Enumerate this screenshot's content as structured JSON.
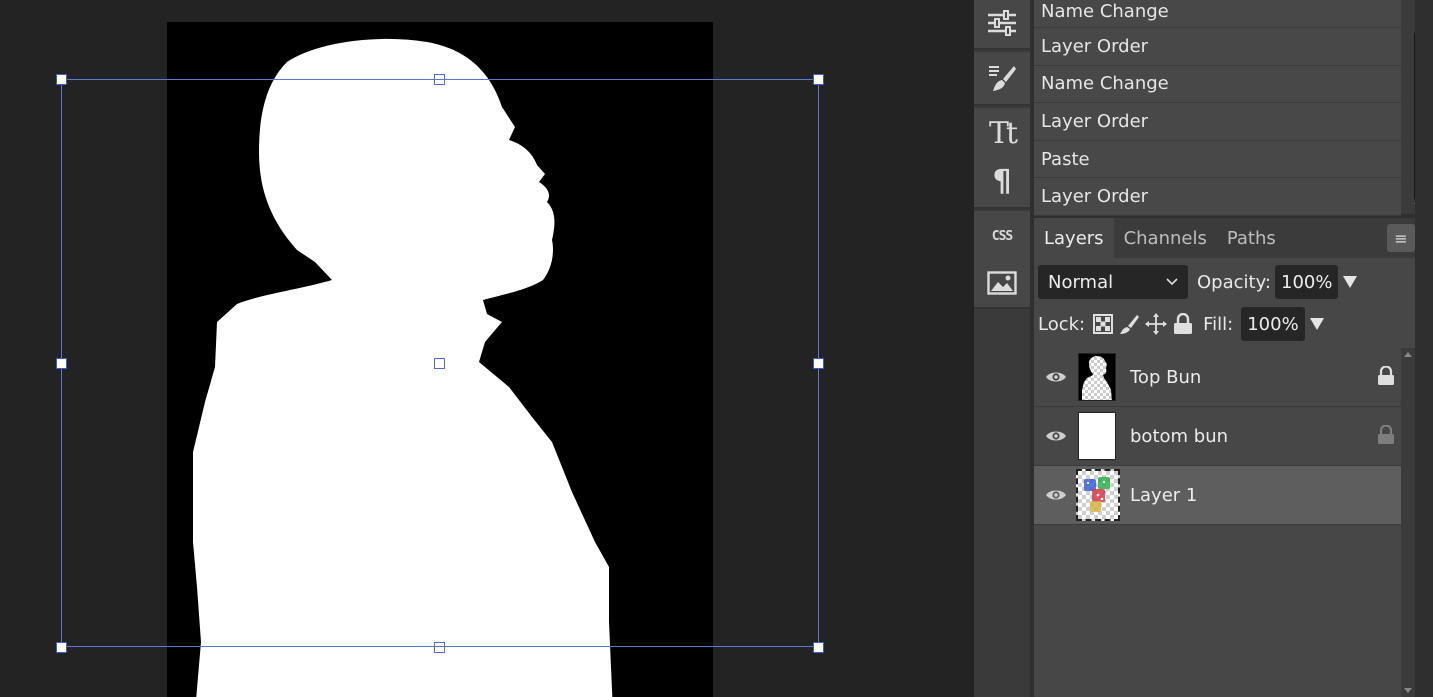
{
  "history": {
    "items": [
      {
        "label": "Name Change"
      },
      {
        "label": "Layer Order"
      },
      {
        "label": "Name Change"
      },
      {
        "label": "Layer Order"
      },
      {
        "label": "Paste"
      },
      {
        "label": "Layer Order"
      }
    ]
  },
  "tools": [
    {
      "icon": "adjustments-sliders-icon"
    },
    {
      "icon": "brush-settings-icon"
    },
    {
      "icon": "character-text-icon"
    },
    {
      "icon": "paragraph-icon"
    },
    {
      "icon": "css-icon"
    },
    {
      "icon": "image-icon"
    }
  ],
  "layers_panel": {
    "tabs": [
      {
        "label": "Layers",
        "active": true
      },
      {
        "label": "Channels",
        "active": false
      },
      {
        "label": "Paths",
        "active": false
      }
    ],
    "menu_glyph": "≡",
    "blend_mode": "Normal",
    "opacity_label": "Opacity:",
    "opacity_value": "100%",
    "lock_label": "Lock:",
    "fill_label": "Fill:",
    "fill_value": "100%",
    "layers": [
      {
        "name": "Top Bun",
        "visible": true,
        "locked": true,
        "selected": false,
        "thumb": "silhouette"
      },
      {
        "name": "botom bun",
        "visible": true,
        "locked": true,
        "selected": false,
        "thumb": "white"
      },
      {
        "name": "Layer 1",
        "visible": true,
        "locked": false,
        "selected": true,
        "thumb": "dice"
      }
    ]
  },
  "colors": {
    "transform_box": "#5a78d6",
    "panel_bg": "#474747",
    "selected_layer": "#5e5e5e"
  }
}
